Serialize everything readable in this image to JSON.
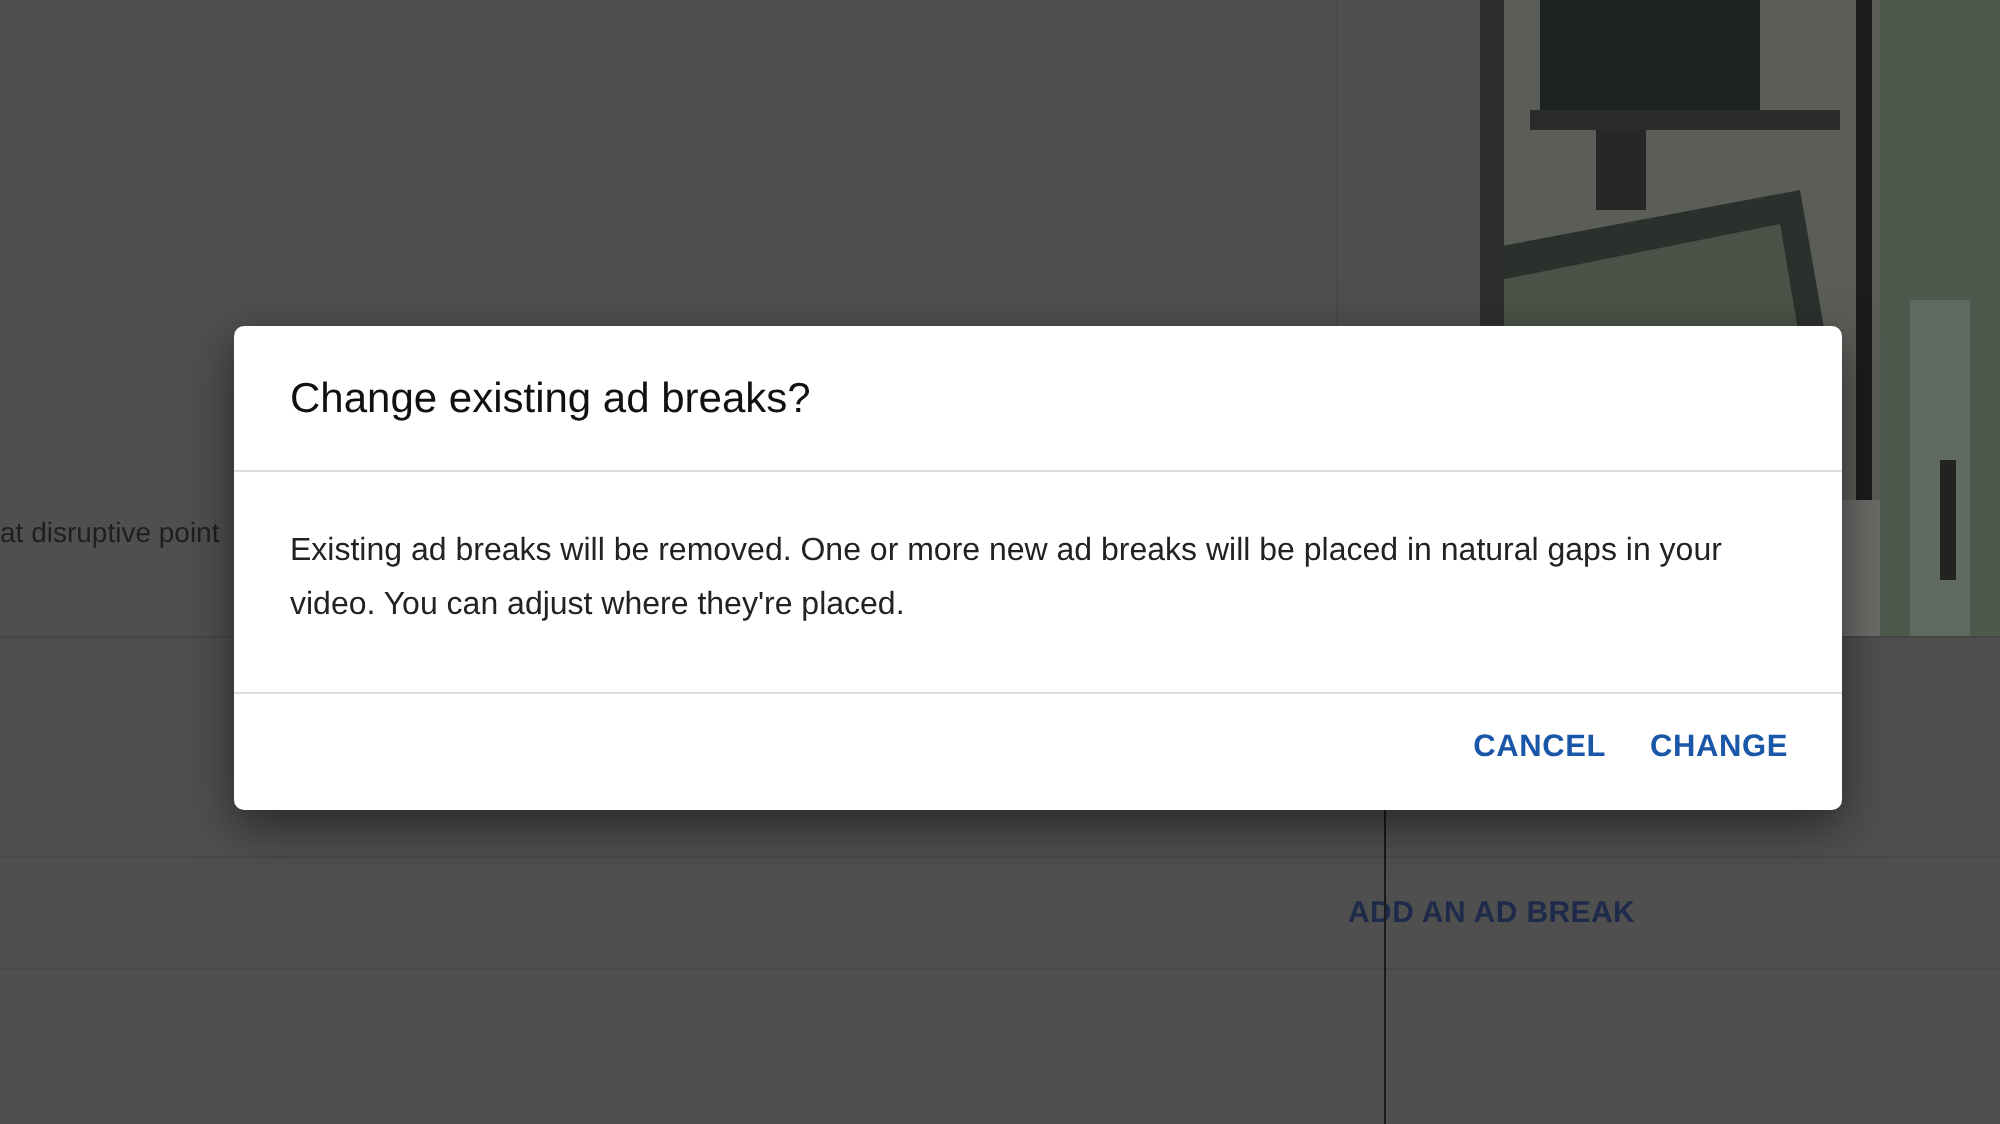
{
  "background": {
    "row_text": "at disruptive point",
    "add_break_link": "ADD AN AD BREAK"
  },
  "dialog": {
    "title": "Change existing ad breaks?",
    "message": "Existing ad breaks will be removed. One or more new ad breaks will be placed in natural gaps in your video. You can adjust where they're placed.",
    "buttons": [
      "CANCEL",
      "CHANGE"
    ]
  }
}
